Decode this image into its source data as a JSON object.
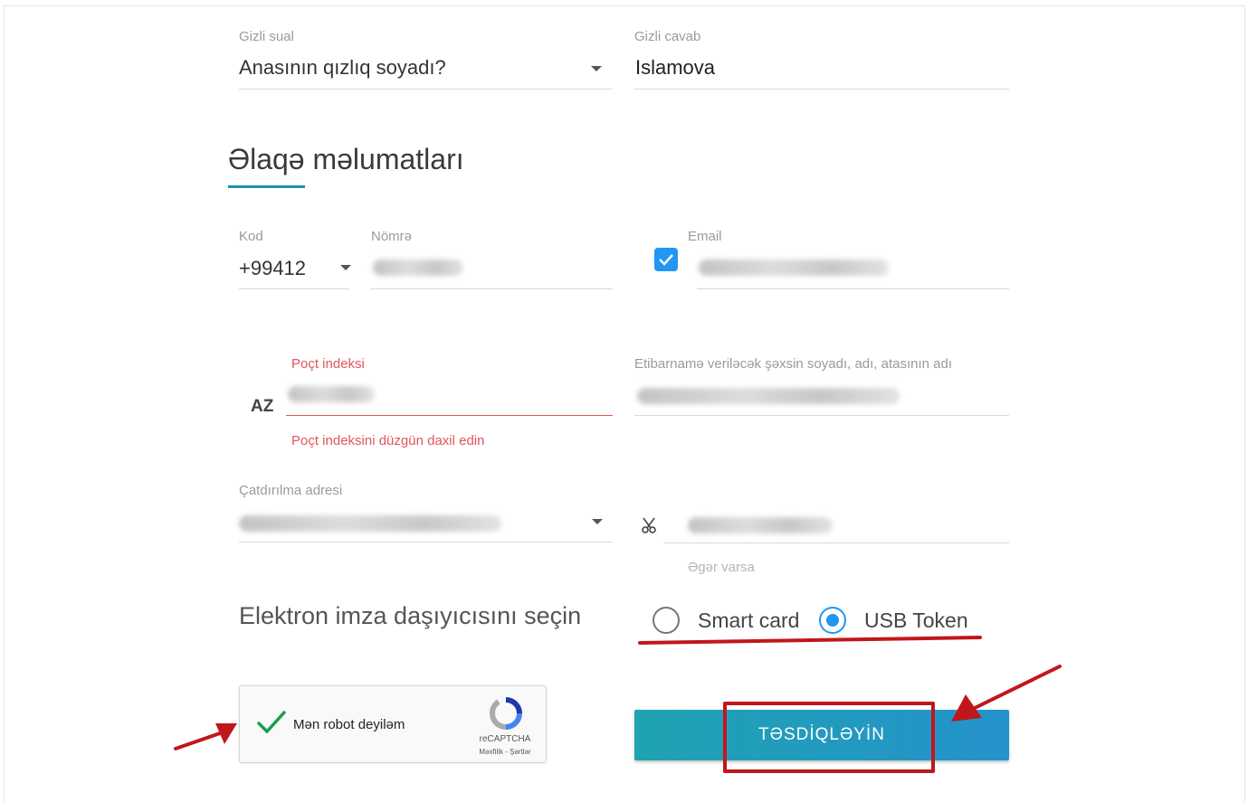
{
  "security": {
    "question_label": "Gizli sual",
    "question_value": "Anasının qızlıq soyadı?",
    "answer_label": "Gizli cavab",
    "answer_value": "Islamova"
  },
  "contact": {
    "section_title": "Əlaqə məlumatları",
    "code_label": "Kod",
    "code_value": "+99412",
    "number_label": "Nömrə",
    "email_label": "Email",
    "email_checked": true
  },
  "postal": {
    "prefix": "AZ",
    "label": "Poçt indeksi",
    "error": "Poçt indeksini düzgün daxil edin",
    "proxy_label": "Etibarnamə veriləcək şəxsin soyadı, adı, atasının adı"
  },
  "delivery": {
    "address_label": "Çatdırılma adresi",
    "optional_hint": "Əgər varsa"
  },
  "signature": {
    "title": "Elektron imza daşıyıcısını seçin",
    "options": [
      "Smart card",
      "USB Token"
    ],
    "selected": "USB Token"
  },
  "captcha": {
    "label": "Mən robot deyiləm",
    "brand": "reCAPTCHA",
    "links": "Məxfilik - Şərtlər"
  },
  "submit_label": "TƏSDİQLƏYİN",
  "colors": {
    "accent": "#2196f3",
    "error": "#e0575b",
    "annotation": "#c0171c",
    "button_gradient_start": "#1fa3b1",
    "button_gradient_end": "#2492cc"
  }
}
